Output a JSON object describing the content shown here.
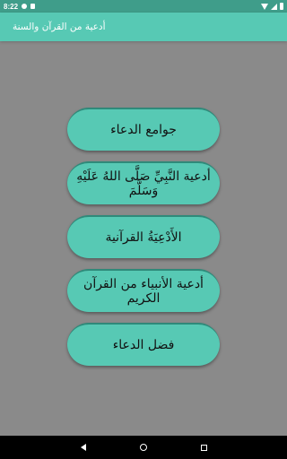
{
  "status_bar": {
    "time": "8:22"
  },
  "app_bar": {
    "title": "أدعية من القرآن والسنة"
  },
  "menu": {
    "items": [
      {
        "label": "جوامع الدعاء"
      },
      {
        "label": "أدعية النَّبِيِّ صَلَّى اللهُ عَلَيْهِ وَسَلَّمَ"
      },
      {
        "label": "الأَدْعِيَةُ القرآنية"
      },
      {
        "label": "أدعية الأنبياء من القرآن الكريم"
      },
      {
        "label": "فضل الدعاء"
      }
    ]
  },
  "colors": {
    "status": "#3f9d8a",
    "primary": "#57c9b4",
    "background": "#8a8a8a"
  },
  "icons": [
    "wifi-icon",
    "signal-icon",
    "battery-icon",
    "back-icon",
    "home-icon",
    "recents-icon"
  ]
}
